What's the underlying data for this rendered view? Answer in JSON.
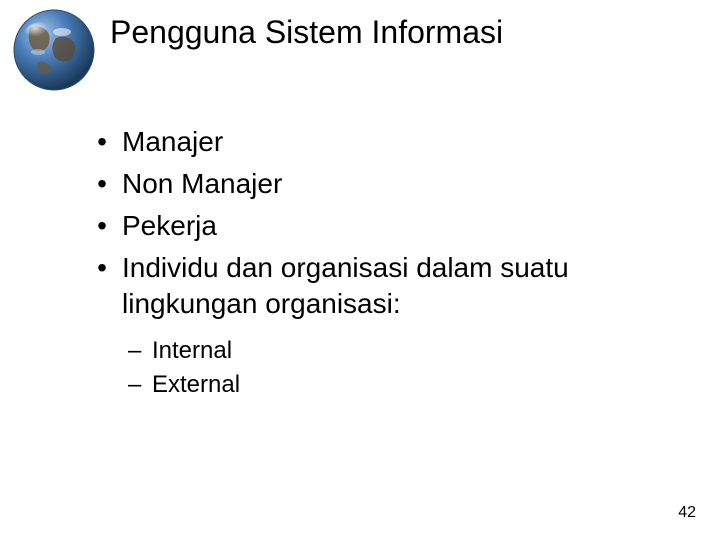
{
  "title": "Pengguna Sistem Informasi",
  "bullets": {
    "0": "Manajer",
    "1": "Non Manajer",
    "2": "Pekerja",
    "3": "Individu dan organisasi dalam suatu lingkungan organisasi:"
  },
  "subbullets": {
    "0": "Internal",
    "1": "External"
  },
  "page_number": "42"
}
